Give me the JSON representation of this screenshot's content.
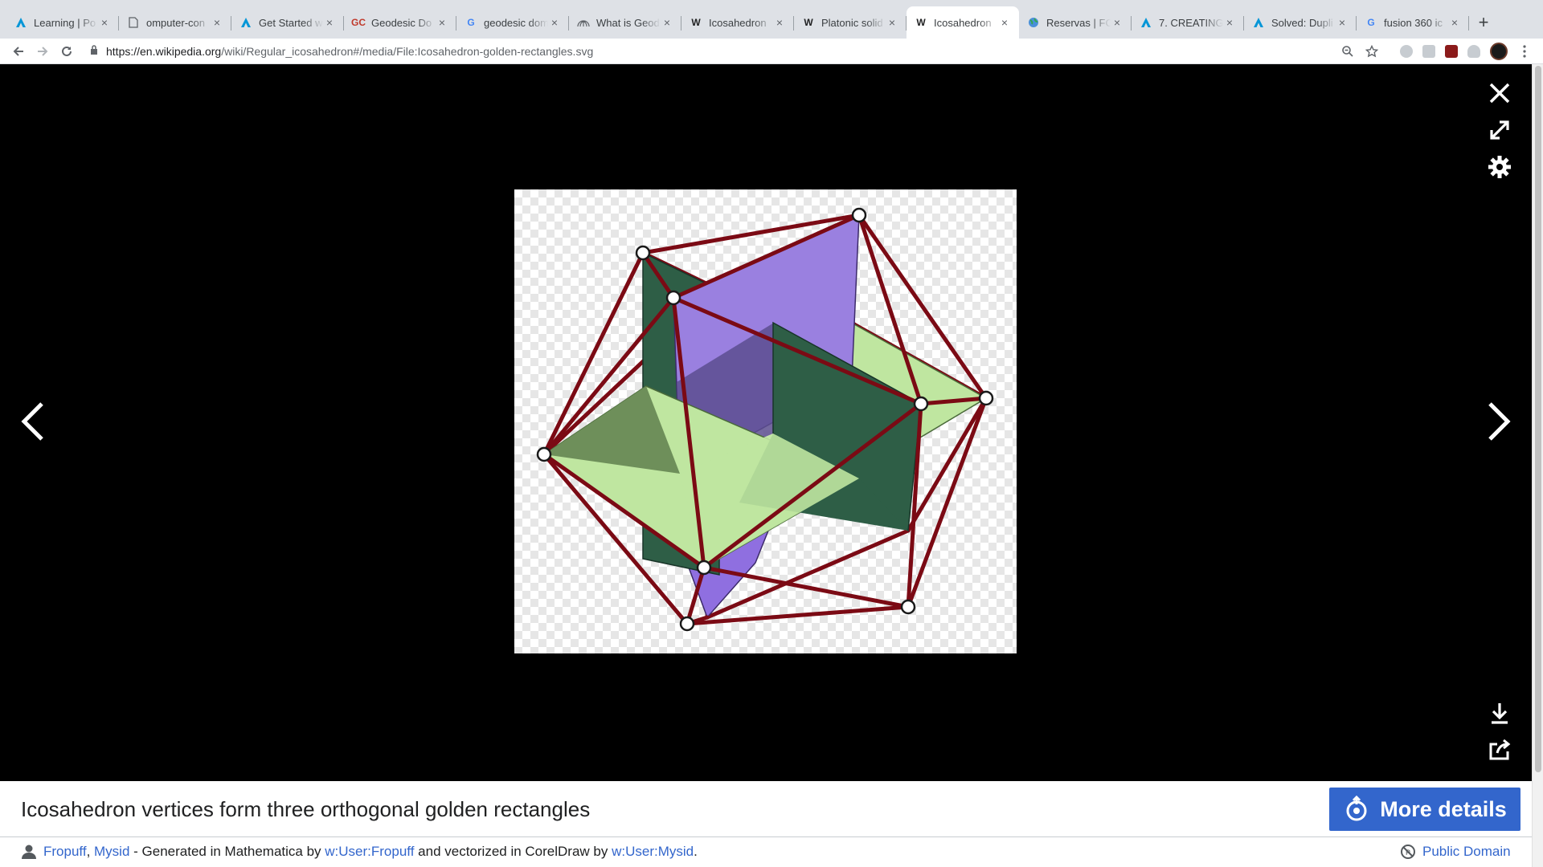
{
  "browser": {
    "tabs": [
      {
        "label": "Learning | Po",
        "favicon": "autodesk-icon",
        "active": false
      },
      {
        "label": "omputer-con",
        "favicon": "document-icon",
        "active": false
      },
      {
        "label": "Get Started w",
        "favicon": "autodesk-icon",
        "active": false
      },
      {
        "label": "Geodesic Do",
        "favicon": "gc-icon",
        "favicon_text": "GC",
        "active": false
      },
      {
        "label": "geodesic dom",
        "favicon": "google-icon",
        "favicon_text": "G",
        "active": false
      },
      {
        "label": "What is Geod",
        "favicon": "dome-icon",
        "active": false
      },
      {
        "label": "Icosahedron",
        "favicon": "wikipedia-icon",
        "favicon_text": "W",
        "active": false
      },
      {
        "label": "Platonic solid",
        "favicon": "wikipedia-icon",
        "favicon_text": "W",
        "active": false
      },
      {
        "label": "Icosahedron",
        "favicon": "wikipedia-icon",
        "favicon_text": "W",
        "active": true
      },
      {
        "label": "Reservas | FC",
        "favicon": "globe-icon",
        "active": false
      },
      {
        "label": "7. CREATING",
        "favicon": "autodesk-icon",
        "active": false
      },
      {
        "label": "Solved: Dupli",
        "favicon": "autodesk-icon",
        "active": false
      },
      {
        "label": "fusion 360 ic",
        "favicon": "google-icon",
        "favicon_text": "G",
        "active": false
      }
    ],
    "new_tab": "+",
    "url_host": "https://en.wikipedia.org",
    "url_path": "/wiki/Regular_icosahedron#/media/File:Icosahedron-golden-rectangles.svg",
    "colors": {
      "tabstrip": "#dee1e6",
      "accent": "#3366cc"
    }
  },
  "viewer": {
    "caption": "Icosahedron vertices form three orthogonal golden rectangles",
    "more_details": "More details",
    "credit": {
      "author1": "Fropuff",
      "sep1": ", ",
      "author2": "Mysid",
      "text1": " - Generated in Mathematica by ",
      "link1": "w:User:Fropuff",
      "text2": " and vectorized in CorelDraw by ",
      "link2": "w:User:Mysid",
      "text3": "."
    },
    "license": "Public Domain",
    "colors": {
      "edge": "#7b0a14",
      "purple": "#9a80e0",
      "dark_green": "#2e5e46",
      "light_green": "#bfe6a0"
    }
  }
}
